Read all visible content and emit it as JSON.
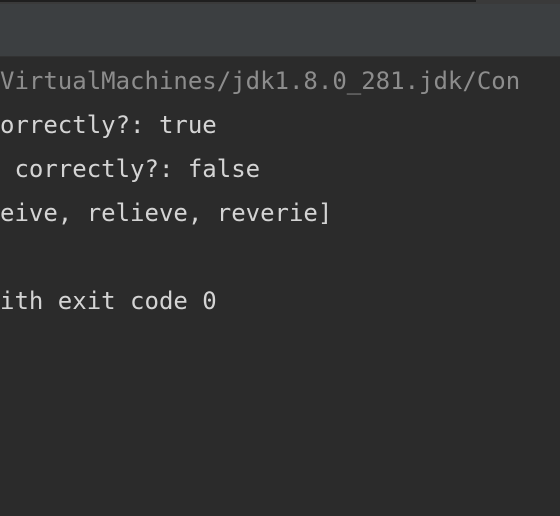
{
  "console": {
    "lines": [
      "VirtualMachines/jdk1.8.0_281.jdk/Con",
      "orrectly?: true",
      " correctly?: false",
      "eive, relieve, reverie]",
      "",
      "ith exit code 0"
    ]
  },
  "colors": {
    "background": "#2b2b2b",
    "toolbar": "#3c3f41",
    "text": "#d4d4d4",
    "path_text": "#8d8d8d"
  }
}
